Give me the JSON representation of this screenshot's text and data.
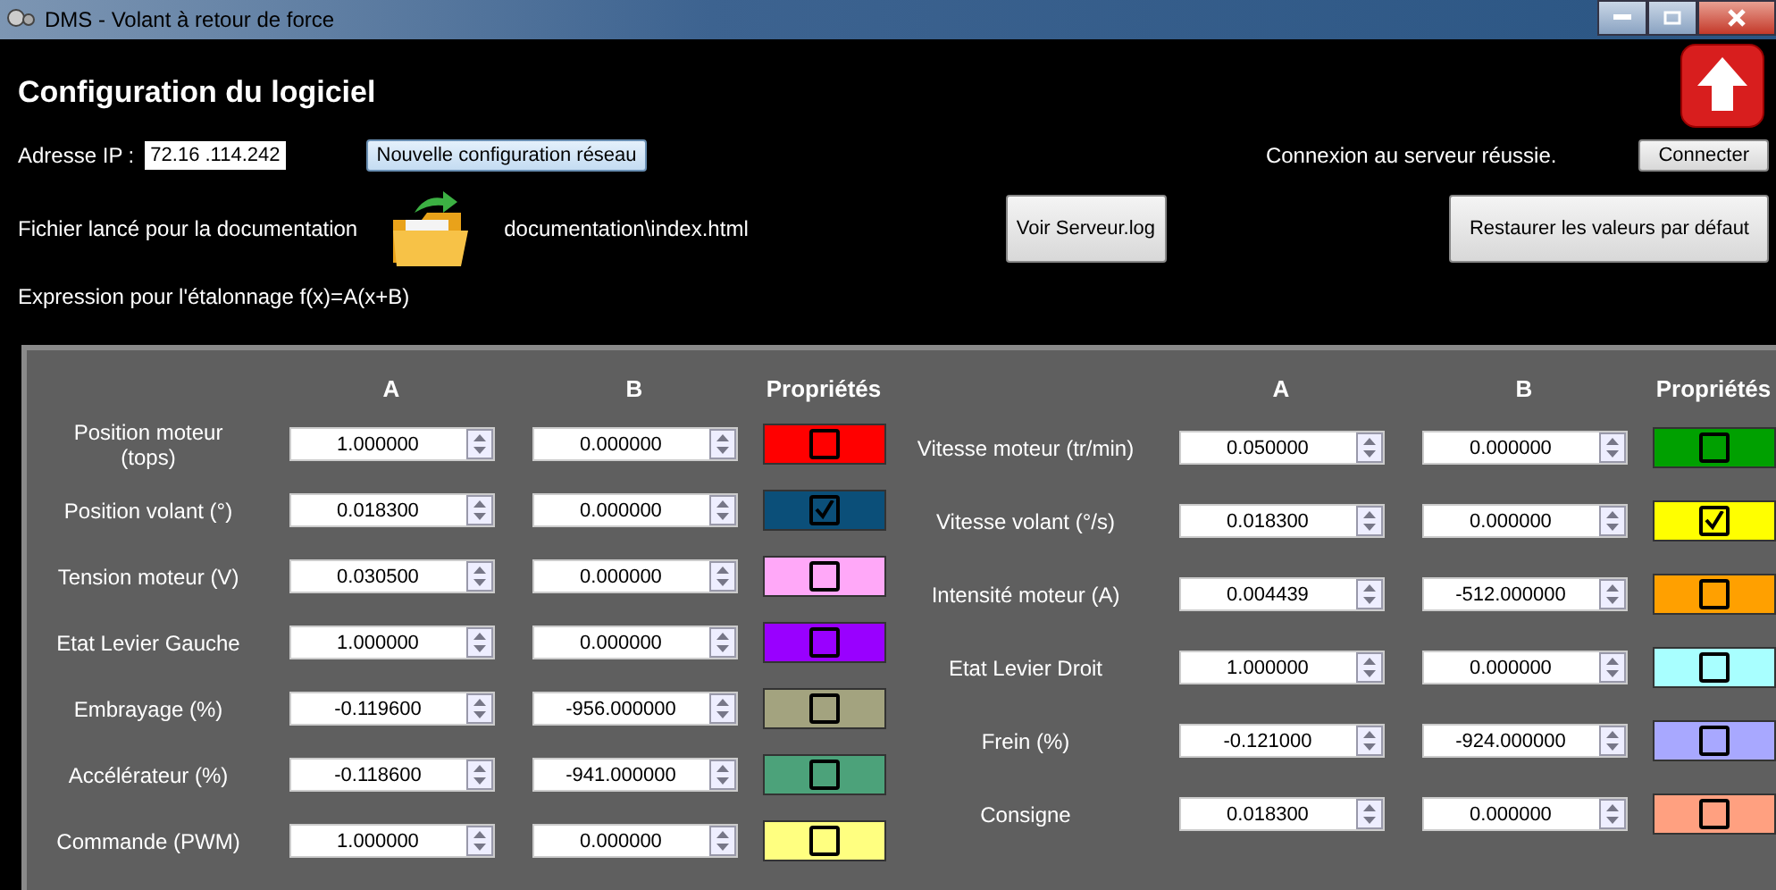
{
  "window": {
    "title": "DMS - Volant à retour de force"
  },
  "heading": "Configuration du logiciel",
  "ip": {
    "label": "Adresse IP :",
    "value": "72.16 .114.242",
    "button": "Nouvelle configuration réseau",
    "status": "Connexion au serveur réussie.",
    "connect_button": "Connecter"
  },
  "documentation": {
    "label": "Fichier lancé pour la documentation",
    "path": "documentation\\index.html",
    "log_button": "Voir Serveur.log",
    "reset_button": "Restaurer les valeurs par défaut"
  },
  "expression": "Expression pour l'étalonnage f(x)=A(x+B)",
  "left_columns": [
    "A",
    "B",
    "Propriétés"
  ],
  "right_columns": [
    "A",
    "B",
    "Propriétés"
  ],
  "left": [
    {
      "label": "Position moteur (tops)",
      "a": "1.000000",
      "b": "0.000000",
      "color": "#ff0000",
      "checked": false
    },
    {
      "label": "Position volant (°)",
      "a": "0.018300",
      "b": "0.000000",
      "color": "#0b4f79",
      "checked": true
    },
    {
      "label": "Tension moteur (V)",
      "a": "0.030500",
      "b": "0.000000",
      "color": "#ffa8f8",
      "checked": false
    },
    {
      "label": "Etat Levier Gauche",
      "a": "1.000000",
      "b": "0.000000",
      "color": "#9900ff",
      "checked": false
    },
    {
      "label": "Embrayage (%)",
      "a": "-0.119600",
      "b": "-956.000000",
      "color": "#a3a37f",
      "checked": false
    },
    {
      "label": "Accélérateur (%)",
      "a": "-0.118600",
      "b": "-941.000000",
      "color": "#4ca27a",
      "checked": false
    },
    {
      "label": "Commande (PWM)",
      "a": "1.000000",
      "b": "0.000000",
      "color": "#ffff80",
      "checked": false
    }
  ],
  "right": [
    {
      "label": "Vitesse moteur (tr/min)",
      "a": "0.050000",
      "b": "0.000000",
      "color": "#00a000",
      "checked": false
    },
    {
      "label": "Vitesse volant (°/s)",
      "a": "0.018300",
      "b": "0.000000",
      "color": "#ffff00",
      "checked": true
    },
    {
      "label": "Intensité moteur (A)",
      "a": "0.004439",
      "b": "-512.000000",
      "color": "#ffa000",
      "checked": false
    },
    {
      "label": "Etat Levier Droit",
      "a": "1.000000",
      "b": "0.000000",
      "color": "#a8ffff",
      "checked": false
    },
    {
      "label": "Frein (%)",
      "a": "-0.121000",
      "b": "-924.000000",
      "color": "#a8a8ff",
      "checked": false
    },
    {
      "label": "Consigne",
      "a": "0.018300",
      "b": "0.000000",
      "color": "#ffa080",
      "checked": false
    }
  ]
}
